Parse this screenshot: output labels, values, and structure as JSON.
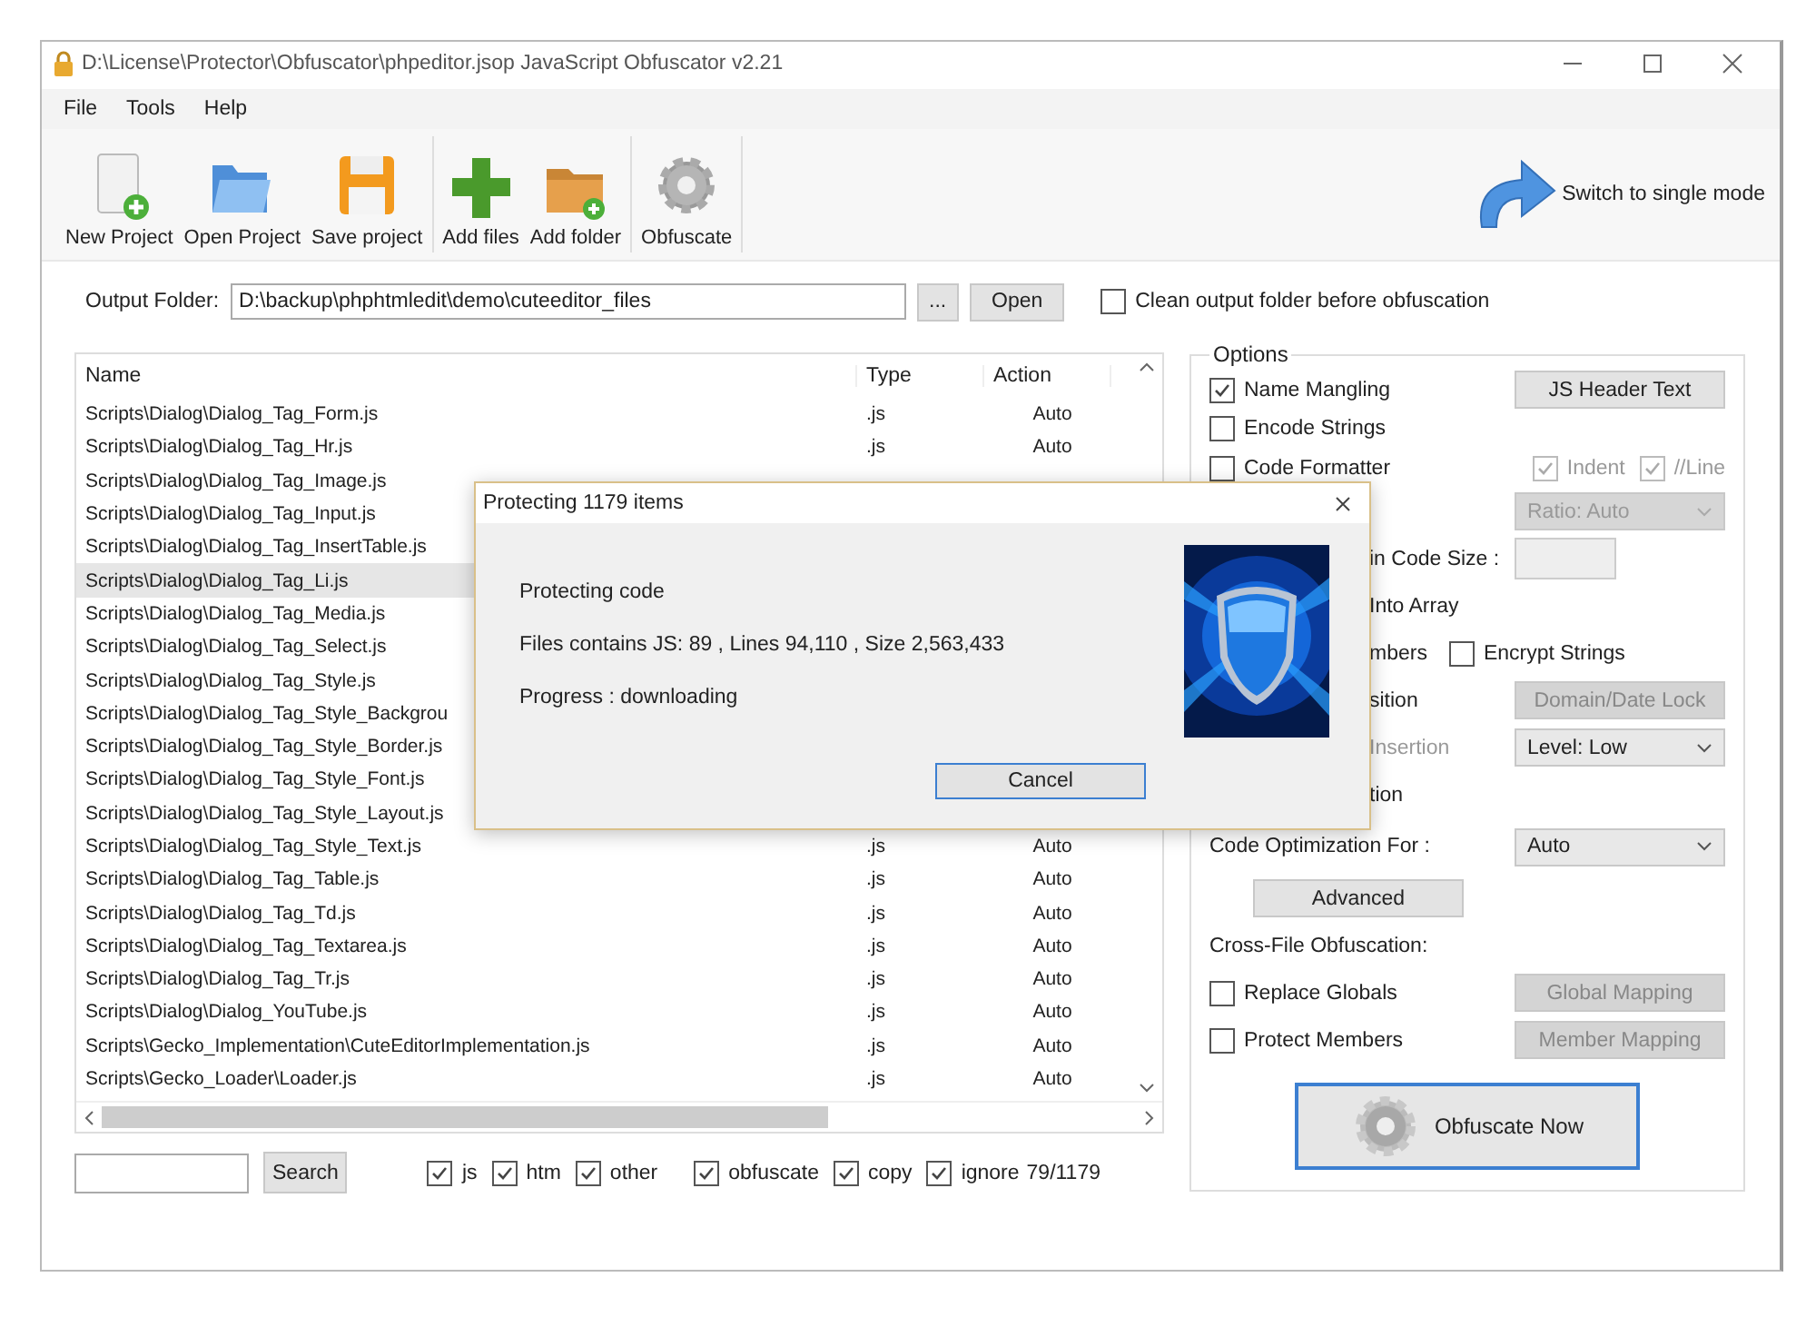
{
  "window": {
    "title": "D:\\License\\Protector\\Obfuscator\\phpeditor.jsop JavaScript Obfuscator v2.21"
  },
  "menu": [
    "File",
    "Tools",
    "Help"
  ],
  "toolbar": {
    "groups": [
      [
        {
          "label": "New Project",
          "kind": "new"
        },
        {
          "label": "Open Project",
          "kind": "open"
        },
        {
          "label": "Save project",
          "kind": "save"
        }
      ],
      [
        {
          "label": "Add files",
          "kind": "add"
        },
        {
          "label": "Add folder",
          "kind": "addfolder"
        }
      ],
      [
        {
          "label": "Obfuscate",
          "kind": "gear"
        }
      ]
    ],
    "switch_mode": "Switch to single mode"
  },
  "output_folder": {
    "label": "Output Folder:",
    "value": "D:\\backup\\phphtmledit\\demo\\cuteeditor_files",
    "browse": "...",
    "open": "Open",
    "clean": {
      "label": "Clean output folder before obfuscation",
      "checked": false
    }
  },
  "file_list": {
    "columns": [
      "Name",
      "Type",
      "Action"
    ],
    "rows": [
      {
        "name": "Scripts\\Dialog\\Dialog_Tag_Form.js",
        "type": ".js",
        "action": "Auto",
        "selected": false
      },
      {
        "name": "Scripts\\Dialog\\Dialog_Tag_Hr.js",
        "type": ".js",
        "action": "Auto",
        "selected": false
      },
      {
        "name": "Scripts\\Dialog\\Dialog_Tag_Image.js",
        "selected": false
      },
      {
        "name": "Scripts\\Dialog\\Dialog_Tag_Input.js",
        "selected": false
      },
      {
        "name": "Scripts\\Dialog\\Dialog_Tag_InsertTable.js",
        "selected": false
      },
      {
        "name": "Scripts\\Dialog\\Dialog_Tag_Li.js",
        "selected": true
      },
      {
        "name": "Scripts\\Dialog\\Dialog_Tag_Media.js",
        "selected": false
      },
      {
        "name": "Scripts\\Dialog\\Dialog_Tag_Select.js",
        "selected": false
      },
      {
        "name": "Scripts\\Dialog\\Dialog_Tag_Style.js",
        "selected": false
      },
      {
        "name": "Scripts\\Dialog\\Dialog_Tag_Style_Backgrou",
        "selected": false
      },
      {
        "name": "Scripts\\Dialog\\Dialog_Tag_Style_Border.js",
        "selected": false
      },
      {
        "name": "Scripts\\Dialog\\Dialog_Tag_Style_Font.js",
        "selected": false
      },
      {
        "name": "Scripts\\Dialog\\Dialog_Tag_Style_Layout.js",
        "selected": false
      },
      {
        "name": "Scripts\\Dialog\\Dialog_Tag_Style_Text.js",
        "type": ".js",
        "action": "Auto",
        "selected": false
      },
      {
        "name": "Scripts\\Dialog\\Dialog_Tag_Table.js",
        "type": ".js",
        "action": "Auto",
        "selected": false
      },
      {
        "name": "Scripts\\Dialog\\Dialog_Tag_Td.js",
        "type": ".js",
        "action": "Auto",
        "selected": false
      },
      {
        "name": "Scripts\\Dialog\\Dialog_Tag_Textarea.js",
        "type": ".js",
        "action": "Auto",
        "selected": false
      },
      {
        "name": "Scripts\\Dialog\\Dialog_Tag_Tr.js",
        "type": ".js",
        "action": "Auto",
        "selected": false
      },
      {
        "name": "Scripts\\Dialog\\Dialog_YouTube.js",
        "type": ".js",
        "action": "Auto",
        "selected": false
      },
      {
        "name": "Scripts\\Gecko_Implementation\\CuteEditorImplementation.js",
        "type": ".js",
        "action": "Auto",
        "selected": false
      },
      {
        "name": "Scripts\\Gecko_Loader\\Loader.js",
        "type": ".js",
        "action": "Auto",
        "selected": false
      }
    ]
  },
  "filter": {
    "search_button": "Search",
    "checks": [
      {
        "label": "js",
        "checked": true
      },
      {
        "label": "htm",
        "checked": true
      },
      {
        "label": "other",
        "checked": true
      },
      {
        "label": "obfuscate",
        "checked": true
      },
      {
        "label": "copy",
        "checked": true
      },
      {
        "label": "ignore",
        "checked": true
      }
    ],
    "count": "79/1179"
  },
  "options": {
    "title": "Options",
    "rows": [
      {
        "kind": "check",
        "label": "Name Mangling",
        "checked": true,
        "button": {
          "label": "JS Header Text",
          "disabled": false
        }
      },
      {
        "kind": "check",
        "label": "Encode Strings",
        "checked": false
      },
      {
        "kind": "check",
        "label": "Code Formatter",
        "checked": false,
        "subchecks": [
          {
            "label": "Indent",
            "checked": true,
            "disabled": true
          },
          {
            "label": "//Line",
            "checked": true,
            "disabled": true
          }
        ]
      },
      {
        "kind": "partial",
        "select": {
          "value": "Ratio: Auto",
          "disabled": true
        }
      },
      {
        "kind": "partial",
        "label": "in Code Size :",
        "input": {
          "disabled": true
        }
      },
      {
        "kind": "partial",
        "label": "Into Array"
      },
      {
        "kind": "partial",
        "label": "mbers",
        "check": {
          "label": "Encrypt Strings",
          "checked": false
        }
      },
      {
        "kind": "partial",
        "label": "sition",
        "button": {
          "label": "Domain/Date Lock",
          "disabled": true
        }
      },
      {
        "kind": "partial",
        "label": "Insertion",
        "disabled": true,
        "select": {
          "value": "Level: Low",
          "disabled": false
        }
      },
      {
        "kind": "partial",
        "label": "tion"
      },
      {
        "kind": "plain",
        "label": "Code Optimization For :",
        "select": {
          "value": "Auto",
          "disabled": false
        }
      },
      {
        "kind": "button",
        "button": {
          "label": "Advanced",
          "disabled": false
        }
      },
      {
        "kind": "heading",
        "label": "Cross-File Obfuscation:"
      },
      {
        "kind": "check",
        "label": "Replace Globals",
        "checked": false,
        "button": {
          "label": "Global Mapping",
          "disabled": true
        }
      },
      {
        "kind": "check",
        "label": "Protect Members",
        "checked": false,
        "button": {
          "label": "Member Mapping",
          "disabled": true
        }
      }
    ],
    "obfuscate_now": "Obfuscate Now"
  },
  "dialog": {
    "title": "Protecting 1179 items",
    "lines": [
      "Protecting code",
      "Files contains JS: 89 , Lines 94,110 , Size 2,563,433",
      "Progress : downloading"
    ],
    "cancel": "Cancel"
  }
}
